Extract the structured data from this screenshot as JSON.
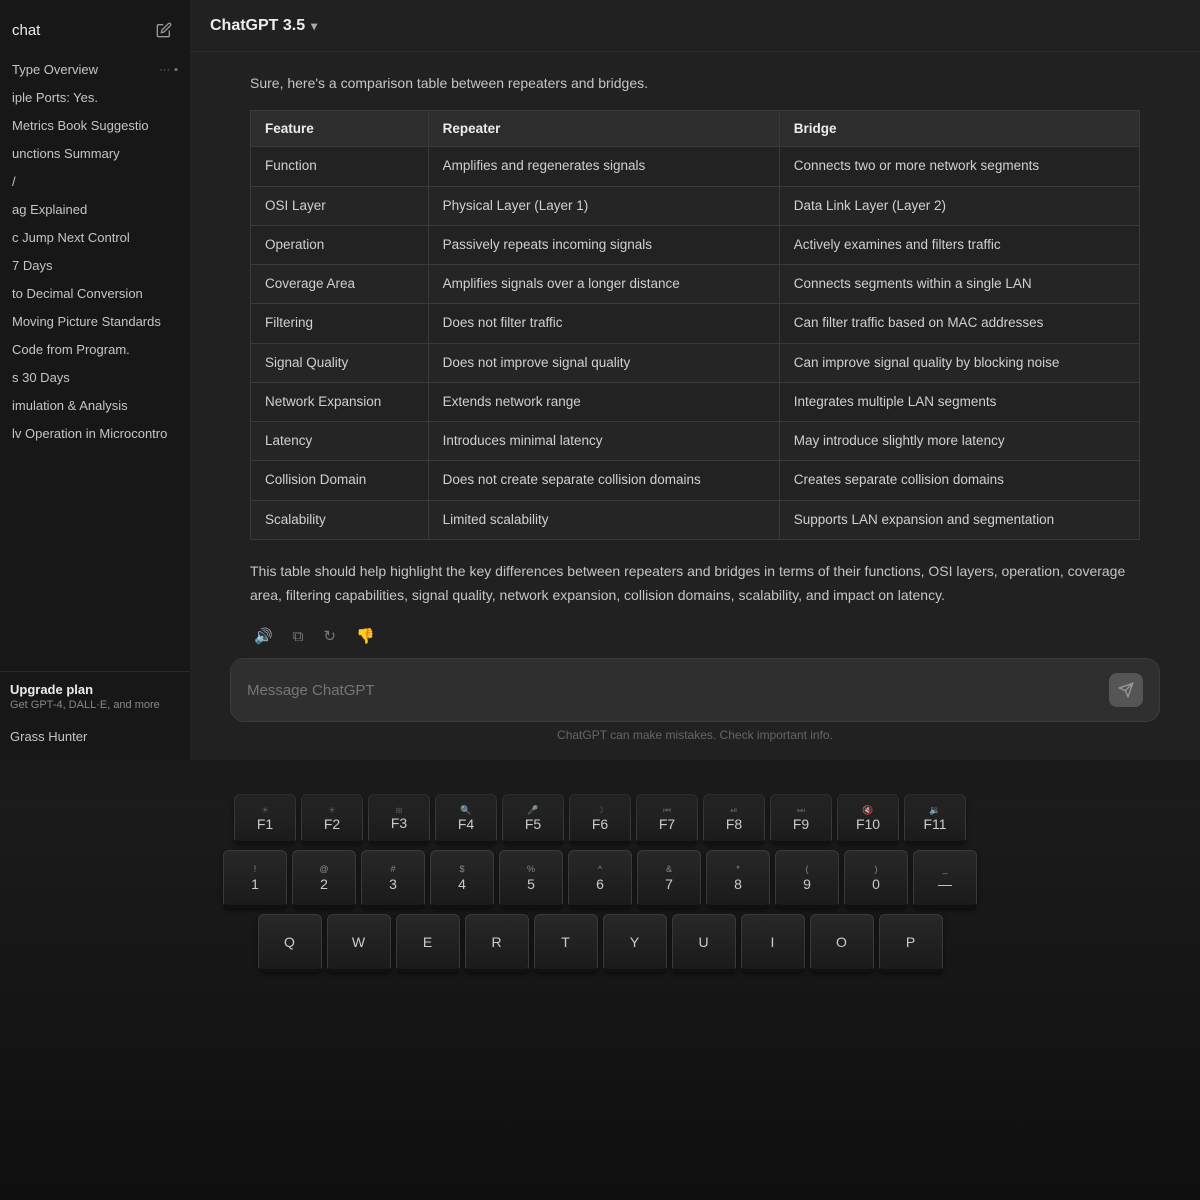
{
  "sidebar": {
    "title": "chat",
    "items": [
      {
        "label": "Type Overview",
        "hasActions": true,
        "actions": "... ▪"
      },
      {
        "label": "iple Ports: Yes.",
        "hasActions": false
      },
      {
        "label": "Metrics Book Suggestio",
        "hasActions": false
      },
      {
        "label": "unctions Summary",
        "hasActions": false
      },
      {
        "label": "/",
        "hasActions": false
      },
      {
        "label": "ag Explained",
        "hasActions": false
      },
      {
        "label": "c Jump Next Control",
        "hasActions": false
      },
      {
        "label": "7 Days",
        "hasActions": false
      },
      {
        "label": "to Decimal Conversion",
        "hasActions": false
      },
      {
        "label": "Moving Picture Standards",
        "hasActions": false
      },
      {
        "label": "Code from Program.",
        "hasActions": false
      },
      {
        "label": "s 30 Days",
        "hasActions": false
      },
      {
        "label": "imulation & Analysis",
        "hasActions": false
      },
      {
        "label": "lv Operation in Microcontro",
        "hasActions": false
      }
    ],
    "upgrade": {
      "title": "Upgrade plan",
      "subtitle": "Get GPT-4, DALL·E, and more"
    },
    "grass_hunter": "Grass Hunter"
  },
  "topbar": {
    "model": "ChatGPT 3.5",
    "chevron": "▾"
  },
  "chat": {
    "intro": "Sure, here's a comparison table between repeaters and bridges.",
    "table": {
      "headers": [
        "Feature",
        "Repeater",
        "Bridge"
      ],
      "rows": [
        [
          "Function",
          "Amplifies and regenerates signals",
          "Connects two or more network segments"
        ],
        [
          "OSI Layer",
          "Physical Layer (Layer 1)",
          "Data Link Layer (Layer 2)"
        ],
        [
          "Operation",
          "Passively repeats incoming signals",
          "Actively examines and filters traffic"
        ],
        [
          "Coverage Area",
          "Amplifies signals over a longer distance",
          "Connects segments within a single LAN"
        ],
        [
          "Filtering",
          "Does not filter traffic",
          "Can filter traffic based on MAC addresses"
        ],
        [
          "Signal Quality",
          "Does not improve signal quality",
          "Can improve signal quality by blocking noise"
        ],
        [
          "Network Expansion",
          "Extends network range",
          "Integrates multiple LAN segments"
        ],
        [
          "Latency",
          "Introduces minimal latency",
          "May introduce slightly more latency"
        ],
        [
          "Collision Domain",
          "Does not create separate collision domains",
          "Creates separate collision domains"
        ],
        [
          "Scalability",
          "Limited scalability",
          "Supports LAN expansion and segmentation"
        ]
      ]
    },
    "summary": "This table should help highlight the key differences between repeaters and bridges in terms of their functions, OSI layers, operation, coverage area, filtering capabilities, signal quality, network expansion, collision domains, scalability, and impact on latency.",
    "actions": {
      "audio": "🔊",
      "copy": "⧉",
      "refresh": "↻",
      "thumbsdown": "👎"
    }
  },
  "input": {
    "placeholder": "Message ChatGPT",
    "footer": "ChatGPT can make mistakes. Check important info."
  },
  "keyboard": {
    "fn_row": [
      {
        "top": "☀",
        "main": "F1"
      },
      {
        "top": "☀",
        "main": "F2"
      },
      {
        "top": "⊞",
        "main": "F3"
      },
      {
        "top": "🔍",
        "main": "F4"
      },
      {
        "top": "🎤",
        "main": "F5"
      },
      {
        "top": "☽",
        "main": "F6"
      },
      {
        "top": "⏮",
        "main": "F7"
      },
      {
        "top": "⏯",
        "main": "F8"
      },
      {
        "top": "⏭",
        "main": "F9"
      },
      {
        "top": "🔇",
        "main": "F10"
      },
      {
        "top": "🔉",
        "main": "F11"
      }
    ],
    "number_row": [
      {
        "top": "!",
        "main": "1"
      },
      {
        "top": "@",
        "main": "2"
      },
      {
        "top": "#",
        "main": "3"
      },
      {
        "top": "$",
        "main": "4"
      },
      {
        "top": "%",
        "main": "5"
      },
      {
        "top": "^",
        "main": "6"
      },
      {
        "top": "&",
        "main": "7"
      },
      {
        "top": "*",
        "main": "8"
      },
      {
        "top": "(",
        "main": "9"
      },
      {
        "top": ")",
        "main": "0"
      },
      {
        "top": "_",
        "main": "—"
      }
    ],
    "qwerty_row": [
      "Q",
      "W",
      "E",
      "R",
      "T",
      "Y",
      "U",
      "I",
      "O",
      "P"
    ]
  }
}
